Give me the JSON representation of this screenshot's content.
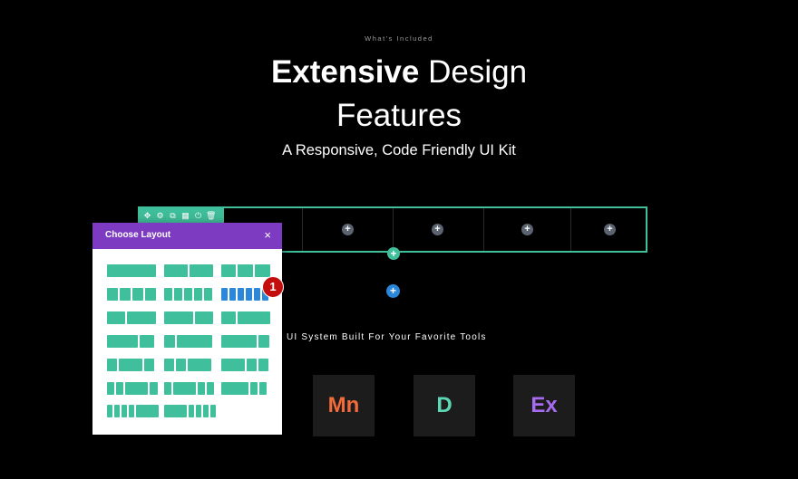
{
  "hero": {
    "eyebrow": "What's Included",
    "title_bold": "Extensive",
    "title_rest": " Design",
    "title_line2": "Features",
    "subtitle": "A Responsive, Code Friendly UI Kit"
  },
  "row": {
    "add_module_label": "+",
    "toolbar_icons": [
      "move-icon",
      "settings-icon",
      "duplicate-icon",
      "columns-icon",
      "toggle-icon",
      "delete-icon"
    ],
    "accent_color": "#3fbf9b"
  },
  "section": {
    "tagline": "UI System Built For Your Favorite Tools",
    "tiles": [
      {
        "label": "Mn",
        "color": "#f26b3a"
      },
      {
        "label": "D",
        "color": "#5cd6b5"
      },
      {
        "label": "Ex",
        "color": "#a66bf0"
      }
    ]
  },
  "modal": {
    "title": "Choose Layout",
    "close_label": "×",
    "header_color": "#7d3bc1",
    "selected_layout": "6 equal columns"
  },
  "badge": {
    "label": "1"
  }
}
